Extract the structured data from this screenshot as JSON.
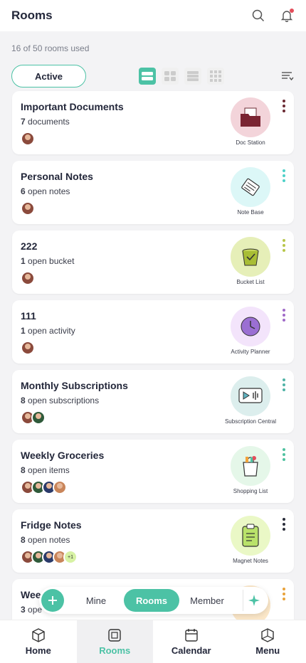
{
  "header": {
    "title": "Rooms"
  },
  "usage_text": "16 of 50 rooms used",
  "filter": {
    "active_label": "Active"
  },
  "rooms": [
    {
      "name": "Important Documents",
      "count": "7",
      "count_suffix": "documents",
      "app": "Doc Station",
      "icon_bg": "#f3d4da",
      "kebab_color": "#6b2a33",
      "avatars": 1
    },
    {
      "name": "Personal Notes",
      "count": "6",
      "count_suffix": "open notes",
      "app": "Note Base",
      "icon_bg": "#dcf7f7",
      "kebab_color": "#4fd1c8",
      "avatars": 1
    },
    {
      "name": "222",
      "count": "1",
      "count_suffix": "open bucket",
      "app": "Bucket List",
      "icon_bg": "#e6efb8",
      "kebab_color": "#b7c64a",
      "avatars": 1
    },
    {
      "name": "111",
      "count": "1",
      "count_suffix": "open activity",
      "app": "Activity Planner",
      "icon_bg": "#f3e4fb",
      "kebab_color": "#a06ac8",
      "avatars": 1
    },
    {
      "name": "Monthly Subscriptions",
      "count": "8",
      "count_suffix": "open subscriptions",
      "app": "Subscription Central",
      "icon_bg": "#dceeed",
      "kebab_color": "#4fb3a6",
      "avatars": 2
    },
    {
      "name": "Weekly Groceries",
      "count": "8",
      "count_suffix": "open items",
      "app": "Shopping List",
      "icon_bg": "#e5f7e9",
      "kebab_color": "#4fc2a0",
      "avatars": 4
    },
    {
      "name": "Fridge Notes",
      "count": "8",
      "count_suffix": "open notes",
      "app": "Magnet Notes",
      "icon_bg": "#eaf8c6",
      "kebab_color": "#2a2d3a",
      "avatars": 4,
      "more": "+1"
    },
    {
      "name": "Wee",
      "count": "3",
      "count_suffix": "ope",
      "app": "",
      "icon_bg": "#fbe7c8",
      "kebab_color": "#e8a23a",
      "avatars": 0
    }
  ],
  "floating_bar": {
    "segments": [
      "Mine",
      "Rooms",
      "Member"
    ],
    "active": "Rooms"
  },
  "tabs": [
    {
      "label": "Home",
      "icon": "home-cube-icon"
    },
    {
      "label": "Rooms",
      "icon": "rooms-icon"
    },
    {
      "label": "Calendar",
      "icon": "calendar-icon"
    },
    {
      "label": "Menu",
      "icon": "menu-cube-icon"
    }
  ],
  "colors": {
    "accent": "#4cc2a5"
  }
}
